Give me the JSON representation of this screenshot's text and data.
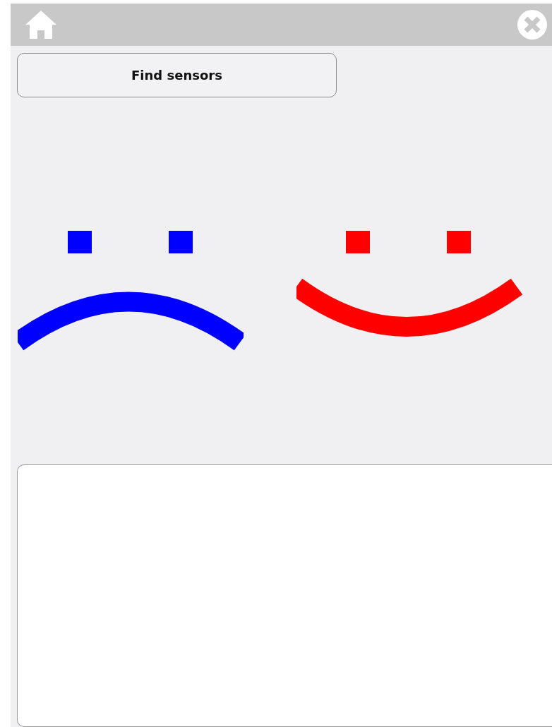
{
  "button": {
    "label": "Find sensors"
  },
  "faces": [
    {
      "kind": "sad",
      "color": "#0000ff"
    },
    {
      "kind": "happy",
      "color": "#ff0000"
    }
  ]
}
